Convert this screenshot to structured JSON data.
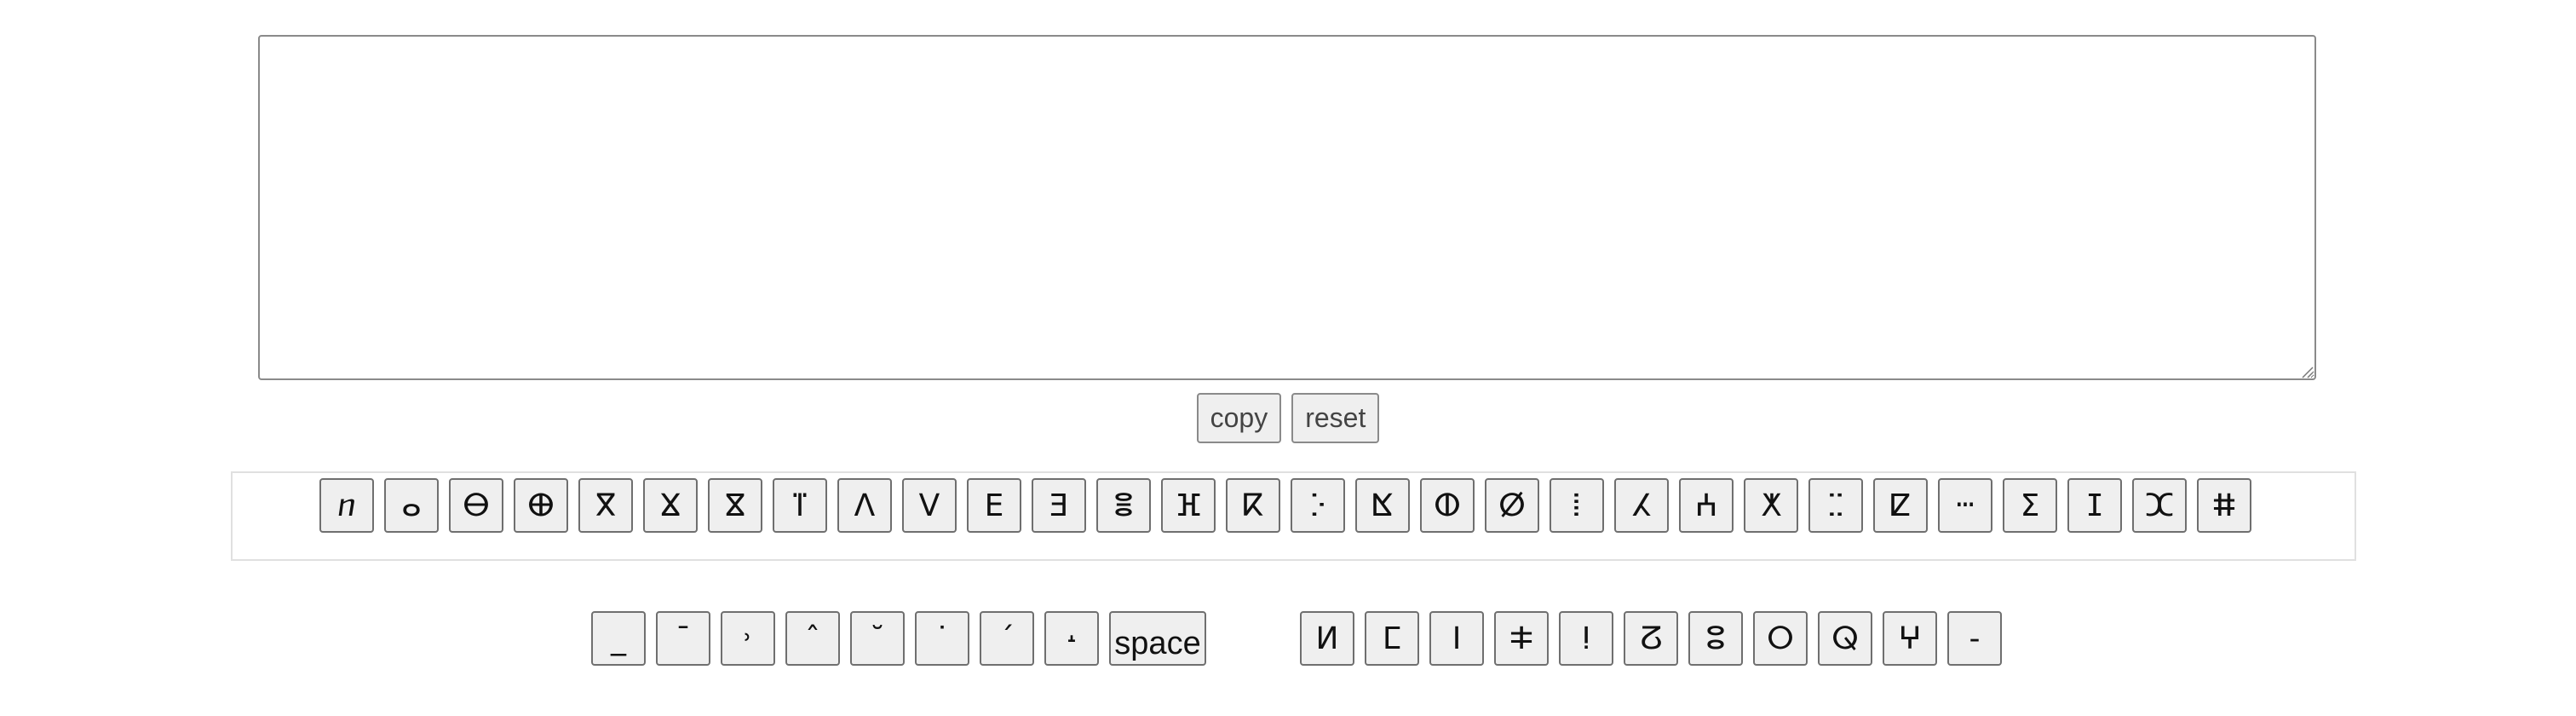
{
  "editor": {
    "value": "",
    "placeholder": ""
  },
  "controls": {
    "copy_label": "copy",
    "reset_label": "reset"
  },
  "keys_main": [
    {
      "label": "ⴖ"
    },
    {
      "label": "ⴰ"
    },
    {
      "label": "ⴱ"
    },
    {
      "label": "ⴲ"
    },
    {
      "label": "ⴳ"
    },
    {
      "label": "ⴴ"
    },
    {
      "label": "ⴵ"
    },
    {
      "label": "ⴶ"
    },
    {
      "label": "ⴷ"
    },
    {
      "label": "ⴸ"
    },
    {
      "label": "ⴹ"
    },
    {
      "label": "ⴺ"
    },
    {
      "label": "ⴻ"
    },
    {
      "label": "ⴼ"
    },
    {
      "label": "ⴽ"
    },
    {
      "label": "ⴾ"
    },
    {
      "label": "ⴿ"
    },
    {
      "label": "ⵀ"
    },
    {
      "label": "ⵁ"
    },
    {
      "label": "ⵂ"
    },
    {
      "label": "ⵃ"
    },
    {
      "label": "ⵄ"
    },
    {
      "label": "ⵅ"
    },
    {
      "label": "ⵆ"
    },
    {
      "label": "ⵇ"
    },
    {
      "label": "ⵈ"
    },
    {
      "label": "ⵉ"
    },
    {
      "label": "ⵊ"
    },
    {
      "label": "ⵋ"
    },
    {
      "label": "ⵌ"
    }
  ],
  "keys_modifiers": [
    {
      "label": "_"
    },
    {
      "label": "¯"
    },
    {
      "label": "˒"
    },
    {
      "label": "ˆ"
    },
    {
      "label": "˘"
    },
    {
      "label": "˙"
    },
    {
      "label": "ˊ"
    },
    {
      "label": "˔"
    },
    {
      "label": "space"
    }
  ],
  "keys_extra": [
    {
      "label": "ⵍ"
    },
    {
      "label": "ⵎ"
    },
    {
      "label": "ⵏ"
    },
    {
      "label": "ⵐ"
    },
    {
      "label": "ⵑ"
    },
    {
      "label": "ⵒ"
    },
    {
      "label": "ⵓ"
    },
    {
      "label": "ⵔ"
    },
    {
      "label": "ⵕ"
    },
    {
      "label": "ⵖ"
    },
    {
      "label": "-"
    }
  ],
  "colors": {
    "key_background": "#efefef",
    "key_border": "#6f6f6f",
    "panel_border": "#e0e0e0"
  }
}
